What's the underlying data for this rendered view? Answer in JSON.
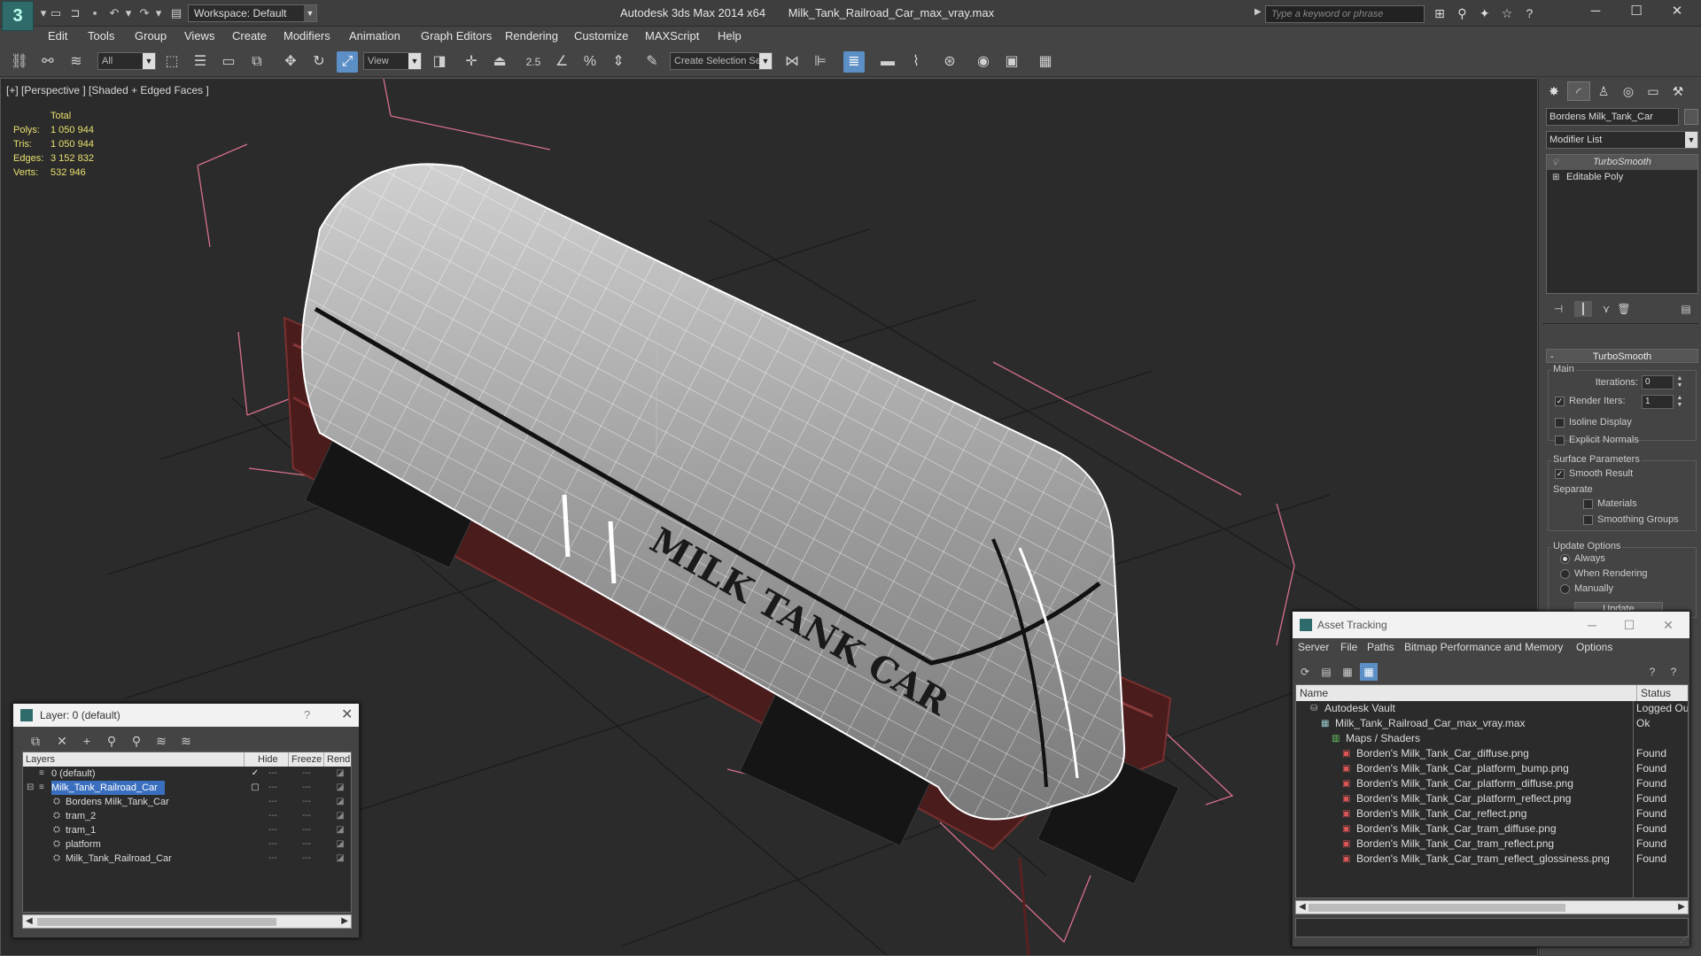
{
  "titlebar": {
    "workspace": "Workspace: Default",
    "app_name": "Autodesk 3ds Max  2014 x64",
    "file_name": "Milk_Tank_Railroad_Car_max_vray.max",
    "search_placeholder": "Type a keyword or phrase"
  },
  "menu": [
    "Edit",
    "Tools",
    "Group",
    "Views",
    "Create",
    "Modifiers",
    "Animation",
    "Graph Editors",
    "Rendering",
    "Customize",
    "MAXScript",
    "Help"
  ],
  "toolbar": {
    "selection_filter": "All",
    "ref_coord": "View",
    "snap_label": "2.5",
    "named_selection": "Create Selection Se"
  },
  "viewport": {
    "label": "[+] [Perspective ] [Shaded + Edged Faces ]",
    "stats": {
      "header": "Total",
      "rows": [
        {
          "label": "Polys:",
          "value": "1 050 944"
        },
        {
          "label": "Tris:",
          "value": "1 050 944"
        },
        {
          "label": "Edges:",
          "value": "3 152 832"
        },
        {
          "label": "Verts:",
          "value": "532 946"
        }
      ]
    },
    "model_lettering": "MILK TANK CAR",
    "colors": {
      "background": "#2b2b2b",
      "wire": "#ffffff",
      "frame": "#6a2a2a",
      "bbox": "#d8708a",
      "grid": "#1a1a1a"
    }
  },
  "command_panel": {
    "object_name": "Bordens Milk_Tank_Car",
    "modifier_list": "Modifier List",
    "stack": [
      "TurboSmooth",
      "Editable Poly"
    ],
    "rollout_title": "TurboSmooth",
    "main_group": "Main",
    "iterations_label": "Iterations:",
    "iterations_value": "0",
    "render_iters_label": "Render Iters:",
    "render_iters_value": "1",
    "isoline_display": "Isoline Display",
    "explicit_normals": "Explicit Normals",
    "surface_params": "Surface Parameters",
    "smooth_result": "Smooth Result",
    "separate": "Separate",
    "materials": "Materials",
    "smoothing_groups": "Smoothing Groups",
    "update_options": "Update Options",
    "always": "Always",
    "when_rendering": "When Rendering",
    "manually": "Manually",
    "update_button": "Update"
  },
  "layer_window": {
    "title": "Layer: 0 (default)",
    "help": "?",
    "columns": [
      "Layers",
      "Hide",
      "Freeze",
      "Rend"
    ],
    "rows": [
      {
        "name": "0 (default)",
        "indent": 0
      },
      {
        "name": "Milk_Tank_Railroad_Car",
        "indent": 0
      },
      {
        "name": "Bordens Milk_Tank_Car",
        "indent": 1
      },
      {
        "name": "tram_2",
        "indent": 1
      },
      {
        "name": "tram_1",
        "indent": 1
      },
      {
        "name": "platform",
        "indent": 1
      },
      {
        "name": "Milk_Tank_Railroad_Car",
        "indent": 1
      }
    ]
  },
  "asset_tracking": {
    "title": "Asset Tracking",
    "menu": [
      "Server",
      "File",
      "Paths",
      "Bitmap Performance and Memory",
      "Options"
    ],
    "columns": [
      "Name",
      "Status"
    ],
    "rows": [
      {
        "name": "Autodesk Vault",
        "status": "Logged Ou",
        "indent": 0,
        "icon": "vault-icon"
      },
      {
        "name": "Milk_Tank_Railroad_Car_max_vray.max",
        "status": "Ok",
        "indent": 1,
        "icon": "max-file-icon"
      },
      {
        "name": "Maps / Shaders",
        "status": "",
        "indent": 2,
        "icon": "maps-icon"
      },
      {
        "name": "Borden's Milk_Tank_Car_diffuse.png",
        "status": "Found",
        "indent": 3,
        "icon": "png-icon"
      },
      {
        "name": "Borden's Milk_Tank_Car_platform_bump.png",
        "status": "Found",
        "indent": 3,
        "icon": "png-icon"
      },
      {
        "name": "Borden's Milk_Tank_Car_platform_diffuse.png",
        "status": "Found",
        "indent": 3,
        "icon": "png-icon"
      },
      {
        "name": "Borden's Milk_Tank_Car_platform_reflect.png",
        "status": "Found",
        "indent": 3,
        "icon": "png-icon"
      },
      {
        "name": "Borden's Milk_Tank_Car_reflect.png",
        "status": "Found",
        "indent": 3,
        "icon": "png-icon"
      },
      {
        "name": "Borden's Milk_Tank_Car_tram_diffuse.png",
        "status": "Found",
        "indent": 3,
        "icon": "png-icon"
      },
      {
        "name": "Borden's Milk_Tank_Car_tram_reflect.png",
        "status": "Found",
        "indent": 3,
        "icon": "png-icon"
      },
      {
        "name": "Borden's Milk_Tank_Car_tram_reflect_glossiness.png",
        "status": "Found",
        "indent": 3,
        "icon": "png-icon"
      }
    ]
  }
}
